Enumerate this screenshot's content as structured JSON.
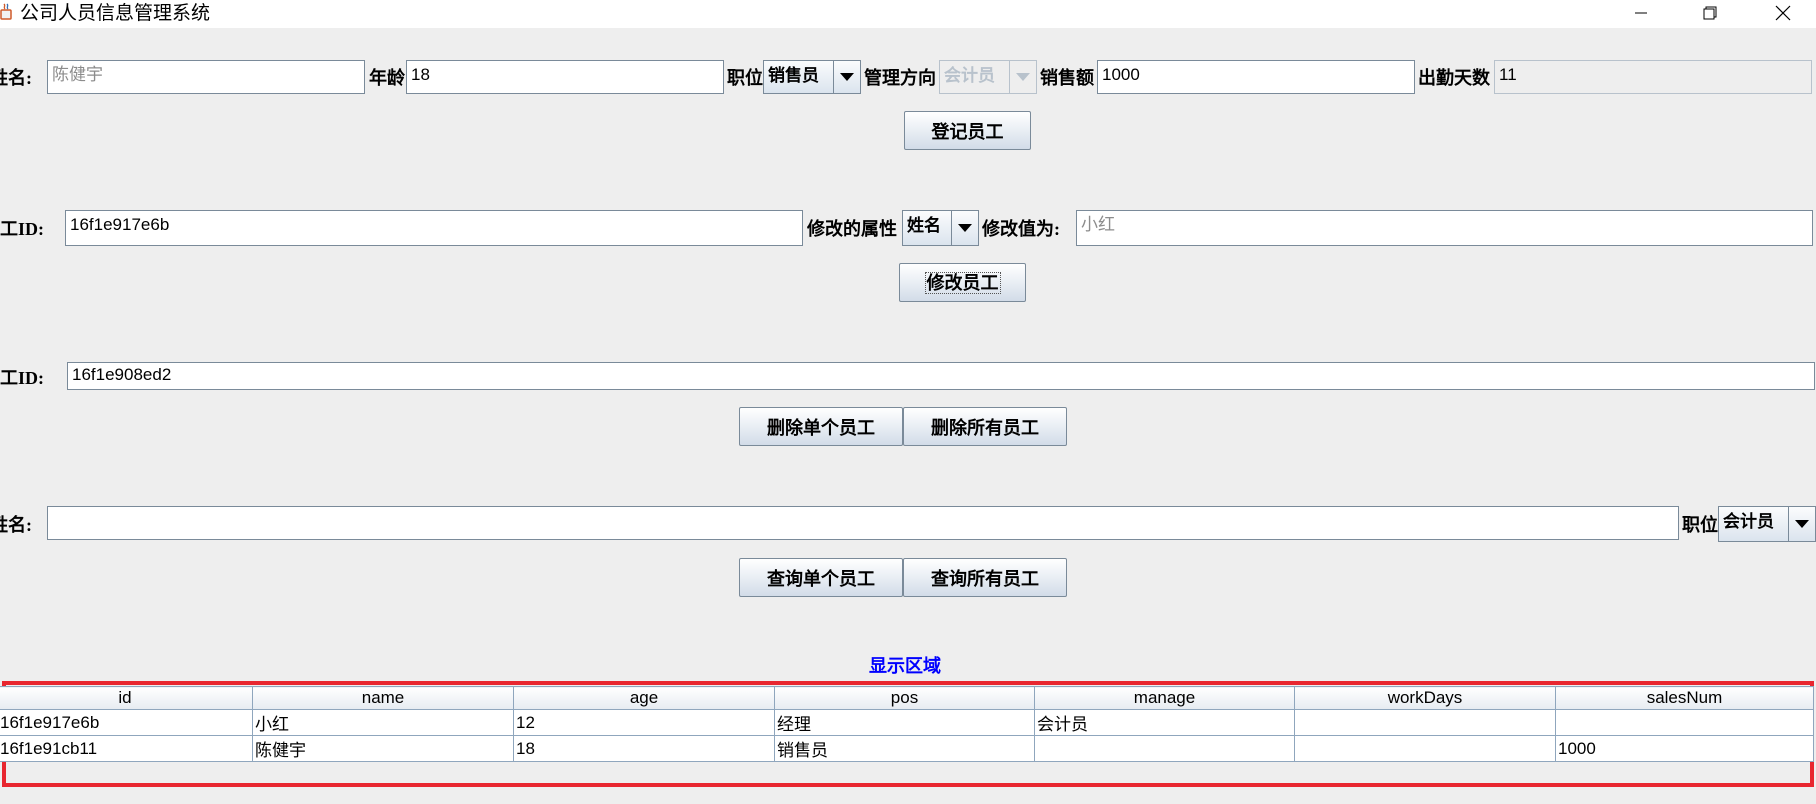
{
  "window": {
    "title": "公司人员信息管理系统",
    "app_icon": "java-cup-icon",
    "controls": [
      "minimize-icon",
      "maximize-icon",
      "close-icon"
    ]
  },
  "register": {
    "name_label": "姓名:",
    "name_value": "陈健宇",
    "age_label": "年龄",
    "age_value": "18",
    "position_label": "职位",
    "position_value": "销售员",
    "manage_label": "管理方向",
    "manage_value": "会计员",
    "sales_label": "销售额",
    "sales_value": "1000",
    "workdays_label": "出勤天数",
    "workdays_value": "11",
    "button": "登记员工"
  },
  "modify": {
    "id_label": "员工ID:",
    "id_value": "16f1e917e6b",
    "attr_label": "修改的属性",
    "attr_value": "姓名",
    "newval_label": "修改值为:",
    "newval_value": "小红",
    "button": "修改员工"
  },
  "delete": {
    "id_label": "员工ID:",
    "id_value": "16f1e908ed2",
    "single_button": "删除单个员工",
    "all_button": "删除所有员工"
  },
  "query": {
    "name_label": "姓名:",
    "name_value": "",
    "position_label": "职位",
    "position_value": "会计员",
    "single_button": "查询单个员工",
    "all_button": "查询所有员工"
  },
  "display": {
    "label": "显示区域",
    "columns": [
      "id",
      "name",
      "age",
      "pos",
      "manage",
      "workDays",
      "salesNum"
    ],
    "rows": [
      [
        "16f1e917e6b",
        "小红",
        "12",
        "经理",
        "会计员",
        "",
        ""
      ],
      [
        "16f1e91cb11",
        "陈健宇",
        "18",
        "销售员",
        "",
        "",
        "1000"
      ]
    ],
    "highlight_color": "#e8262f"
  }
}
